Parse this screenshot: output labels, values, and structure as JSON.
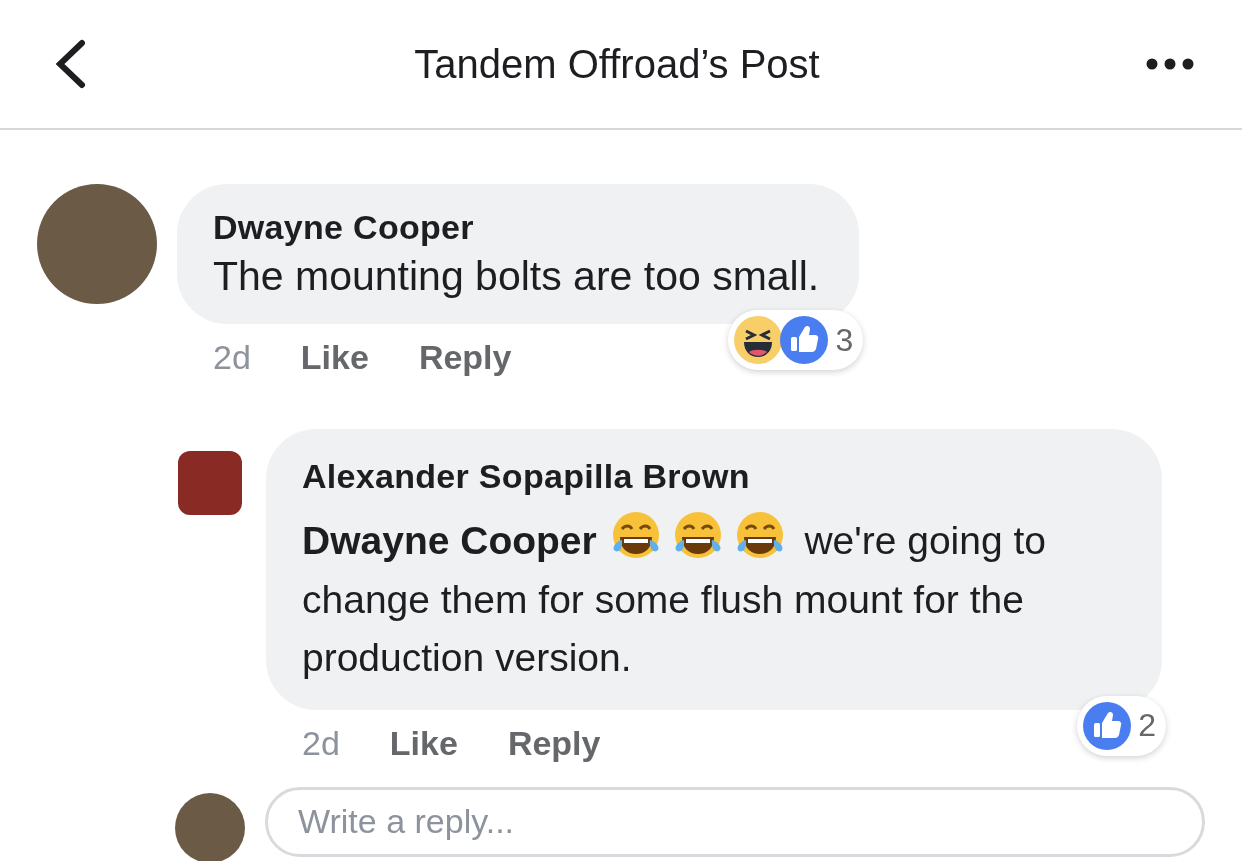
{
  "header": {
    "title": "Tandem Offroad’s Post"
  },
  "comments": [
    {
      "author": "Dwayne Cooper",
      "body": [
        {
          "kind": "text",
          "text": "The mounting bolts are too small."
        }
      ],
      "time": "2d",
      "actions": [
        "Like",
        "Reply"
      ],
      "reactions": {
        "types": [
          {
            "kind": "haha"
          },
          {
            "kind": "like"
          }
        ],
        "count": "3"
      },
      "replies": [
        {
          "author": "Alexander Sopapilla Brown",
          "body": [
            {
              "kind": "mention",
              "text": "Dwayne Cooper"
            },
            {
              "kind": "emoji"
            },
            {
              "kind": "emoji"
            },
            {
              "kind": "emoji"
            },
            {
              "kind": "text",
              "text": "we're going to change them for some flush mount for the production version."
            }
          ],
          "time": "2d",
          "actions": [
            "Like",
            "Reply"
          ],
          "reactions": {
            "types": [
              {
                "kind": "like"
              }
            ],
            "count": "2"
          }
        }
      ]
    }
  ],
  "reply_box": {
    "placeholder": "Write a reply..."
  }
}
